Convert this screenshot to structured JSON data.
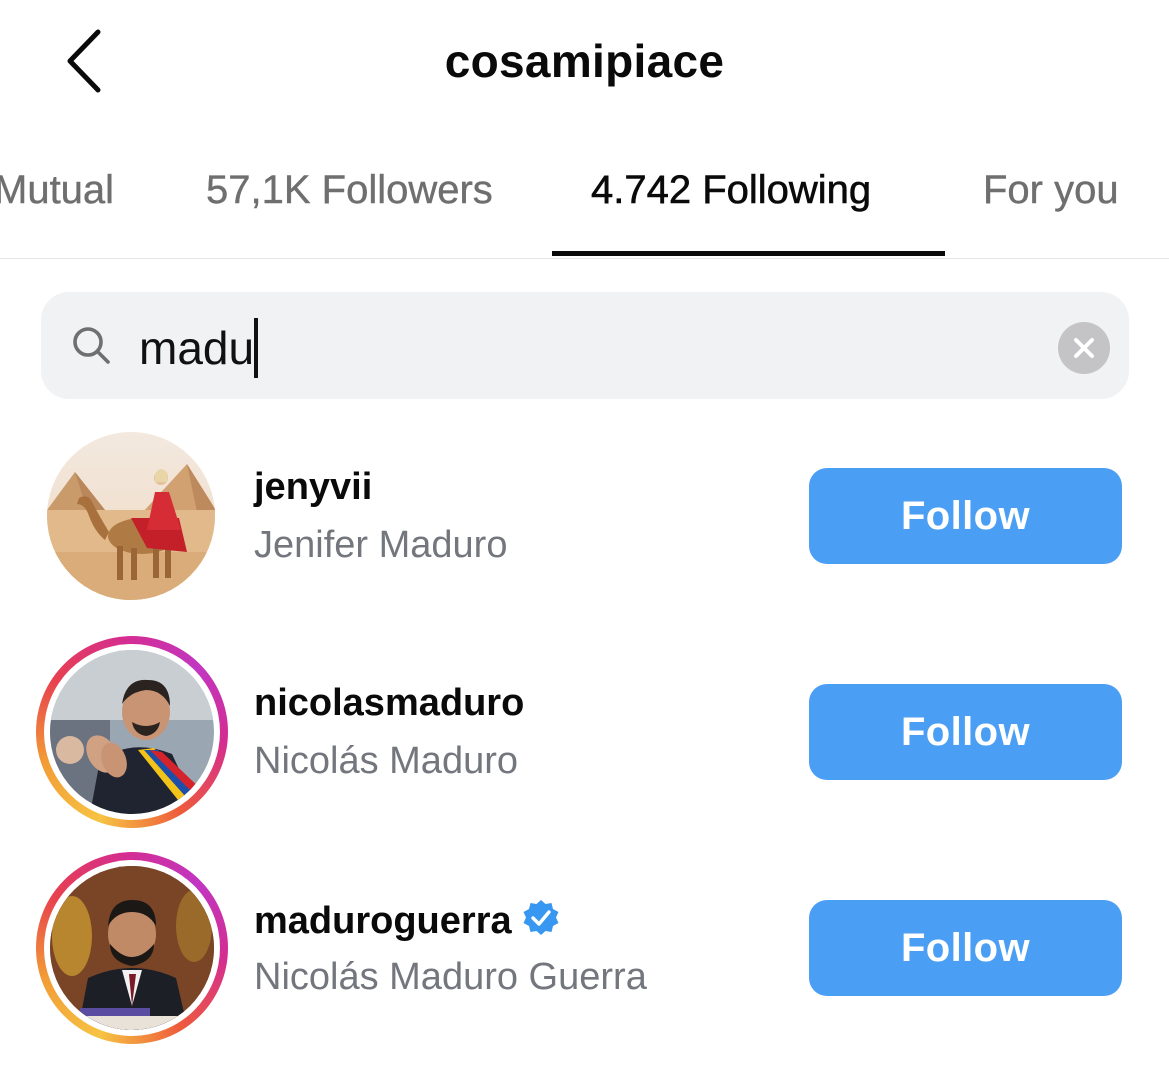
{
  "header": {
    "back_icon": "chevron-left-icon",
    "title": "cosamipiace"
  },
  "tabs": [
    {
      "label": "Mutual",
      "active": false
    },
    {
      "label": "57,1K Followers",
      "active": false
    },
    {
      "label": "4.742 Following",
      "active": true
    },
    {
      "label": "For you",
      "active": false
    }
  ],
  "search": {
    "icon": "search-icon",
    "value": "madu",
    "clear_icon": "clear-icon"
  },
  "results": [
    {
      "username": "jenyvii",
      "full_name": "Jenifer Maduro",
      "verified": false,
      "has_story": false,
      "button_label": "Follow"
    },
    {
      "username": "nicolasmaduro",
      "full_name": "Nicolás Maduro",
      "verified": false,
      "has_story": true,
      "button_label": "Follow"
    },
    {
      "username": "maduroguerra",
      "full_name": "Nicolás Maduro Guerra",
      "verified": true,
      "has_story": true,
      "button_label": "Follow"
    }
  ],
  "colors": {
    "follow_button": "#4a9ff4",
    "verified_badge": "#3897f0",
    "secondary_text": "#73777d",
    "search_bg": "#f1f2f4"
  }
}
